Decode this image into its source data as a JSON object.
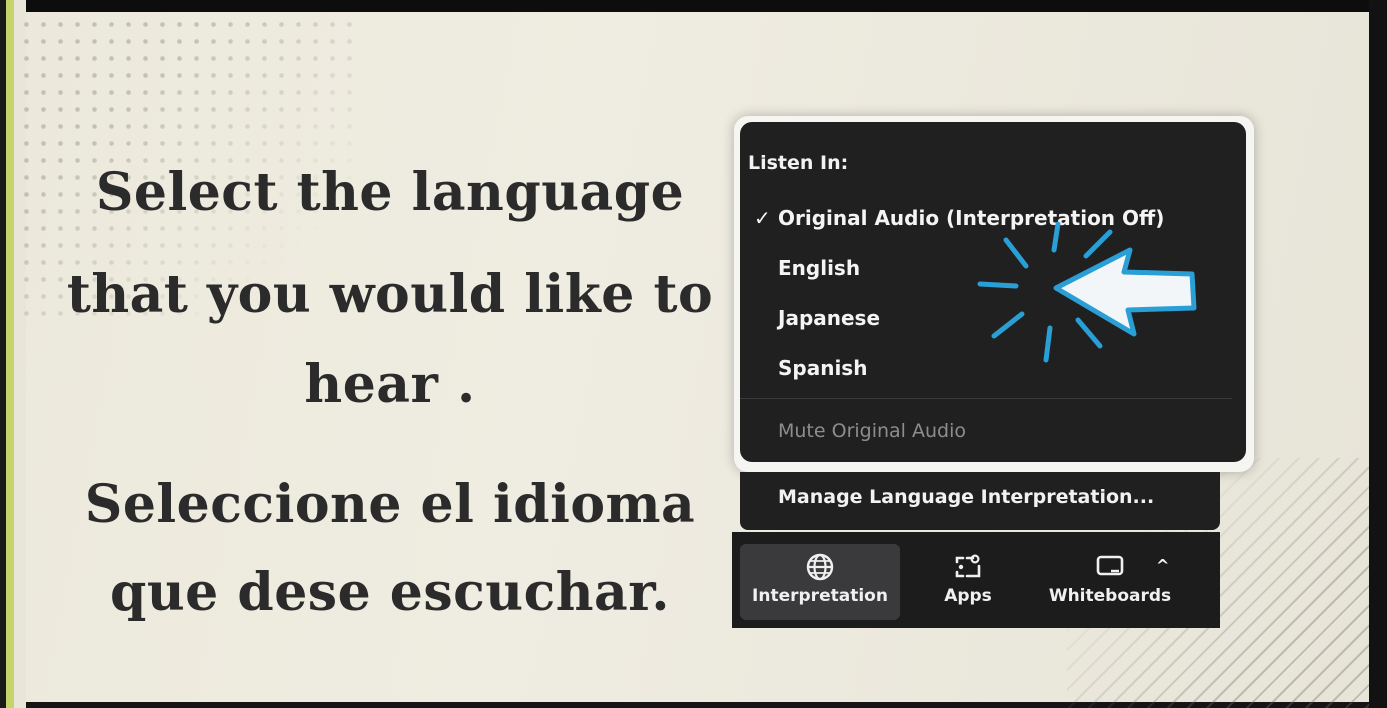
{
  "slide": {
    "english_line1": "Select the language",
    "english_line2": "that you would like to",
    "english_line3": "hear .",
    "spanish_line1": "Seleccione el idioma",
    "spanish_line2": "que dese escuchar."
  },
  "listen_menu": {
    "title": "Listen In:",
    "check_mark": "✓",
    "items": [
      {
        "label": "Original Audio (Interpretation Off)",
        "selected": true
      },
      {
        "label": "English",
        "selected": false
      },
      {
        "label": "Japanese",
        "selected": false
      },
      {
        "label": "Spanish",
        "selected": false
      }
    ],
    "mute_label": "Mute Original Audio",
    "manage_label": "Manage Language Interpretation..."
  },
  "toolbar": {
    "buttons": [
      {
        "label": "Interpretation",
        "icon": "globe-icon",
        "active": true
      },
      {
        "label": "Apps",
        "icon": "apps-icon",
        "active": false
      },
      {
        "label": "Whiteboards",
        "icon": "whiteboard-icon",
        "active": false
      }
    ],
    "more_caret": "^"
  },
  "colors": {
    "menu_bg": "#202021",
    "pointer_accent": "#2a9fd6",
    "slide_bg": "#ece9dc"
  }
}
